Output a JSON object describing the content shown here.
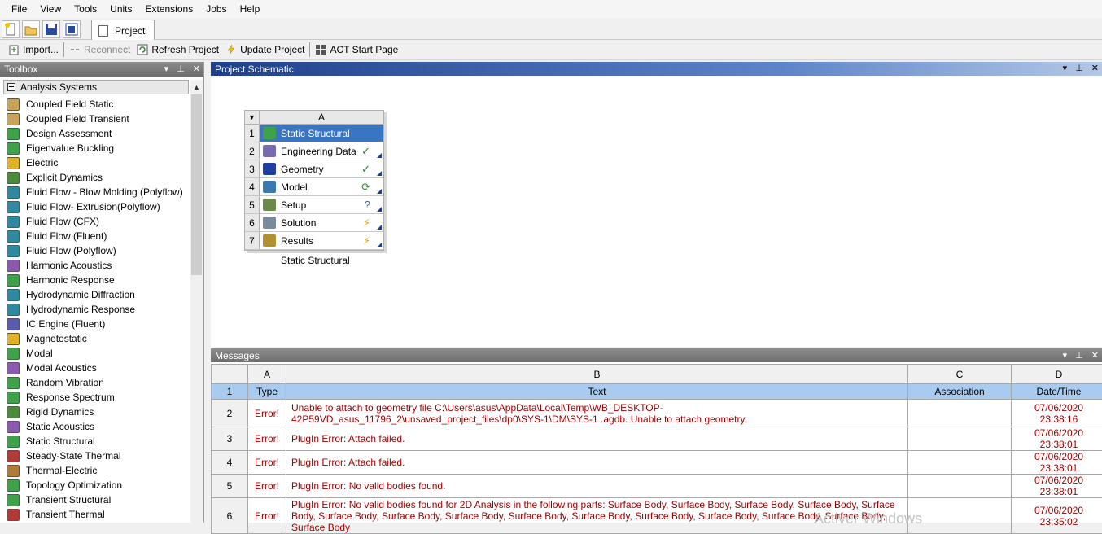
{
  "menu": [
    "File",
    "View",
    "Tools",
    "Units",
    "Extensions",
    "Jobs",
    "Help"
  ],
  "tab": {
    "label": "Project"
  },
  "actions": {
    "import": "Import...",
    "reconnect": "Reconnect",
    "refresh": "Refresh Project",
    "update": "Update Project",
    "act_start": "ACT Start Page"
  },
  "toolbox": {
    "title": "Toolbox",
    "pin": "▾",
    "dock": "⊥",
    "close": "✕",
    "group": "Analysis Systems",
    "items": [
      {
        "label": "Coupled Field Static",
        "color": "#c9a35a"
      },
      {
        "label": "Coupled Field Transient",
        "color": "#c9a35a"
      },
      {
        "label": "Design Assessment",
        "color": "#3ea24a"
      },
      {
        "label": "Eigenvalue Buckling",
        "color": "#3ea24a"
      },
      {
        "label": "Electric",
        "color": "#e0b22a"
      },
      {
        "label": "Explicit Dynamics",
        "color": "#4a8a3a"
      },
      {
        "label": "Fluid Flow - Blow Molding (Polyflow)",
        "color": "#2f8aa0"
      },
      {
        "label": "Fluid Flow- Extrusion(Polyflow)",
        "color": "#2f8aa0"
      },
      {
        "label": "Fluid Flow (CFX)",
        "color": "#2f8aa0"
      },
      {
        "label": "Fluid Flow (Fluent)",
        "color": "#2f8aa0"
      },
      {
        "label": "Fluid Flow (Polyflow)",
        "color": "#2f8aa0"
      },
      {
        "label": "Harmonic Acoustics",
        "color": "#8a5ab0"
      },
      {
        "label": "Harmonic Response",
        "color": "#3ea24a"
      },
      {
        "label": "Hydrodynamic Diffraction",
        "color": "#2f8aa0"
      },
      {
        "label": "Hydrodynamic Response",
        "color": "#2f8aa0"
      },
      {
        "label": "IC Engine (Fluent)",
        "color": "#5a5ab0"
      },
      {
        "label": "Magnetostatic",
        "color": "#e0b22a"
      },
      {
        "label": "Modal",
        "color": "#3ea24a"
      },
      {
        "label": "Modal Acoustics",
        "color": "#8a5ab0"
      },
      {
        "label": "Random Vibration",
        "color": "#3ea24a"
      },
      {
        "label": "Response Spectrum",
        "color": "#3ea24a"
      },
      {
        "label": "Rigid Dynamics",
        "color": "#4a8a3a"
      },
      {
        "label": "Static Acoustics",
        "color": "#8a5ab0"
      },
      {
        "label": "Static Structural",
        "color": "#3ea24a"
      },
      {
        "label": "Steady-State Thermal",
        "color": "#b03a3a"
      },
      {
        "label": "Thermal-Electric",
        "color": "#b07a3a"
      },
      {
        "label": "Topology Optimization",
        "color": "#3ea24a"
      },
      {
        "label": "Transient Structural",
        "color": "#3ea24a"
      },
      {
        "label": "Transient Thermal",
        "color": "#b03a3a"
      }
    ]
  },
  "schematic": {
    "title": "Project Schematic",
    "pin": "▾",
    "dock": "⊥",
    "close": "✕",
    "system": {
      "column": "A",
      "caption": "Static Structural",
      "rows": [
        {
          "num": "1",
          "label": "Static Structural",
          "state": "",
          "icon_color": "#3ea24a"
        },
        {
          "num": "2",
          "label": "Engineering Data",
          "state": "✓",
          "icon_color": "#7a6ab0"
        },
        {
          "num": "3",
          "label": "Geometry",
          "state": "✓",
          "icon_color": "#1e3ea0"
        },
        {
          "num": "4",
          "label": "Model",
          "state": "⟳",
          "icon_color": "#3a7ab0"
        },
        {
          "num": "5",
          "label": "Setup",
          "state": "?",
          "icon_color": "#6a8a4a"
        },
        {
          "num": "6",
          "label": "Solution",
          "state": "⚡",
          "icon_color": "#7a8a9a"
        },
        {
          "num": "7",
          "label": "Results",
          "state": "⚡",
          "icon_color": "#b09030"
        }
      ]
    }
  },
  "messages": {
    "title": "Messages",
    "pin": "▾",
    "dock": "⊥",
    "close": "✕",
    "col_letters": [
      "A",
      "B",
      "C",
      "D"
    ],
    "headers": {
      "row": "1",
      "type": "Type",
      "text": "Text",
      "association": "Association",
      "datetime": "Date/Time"
    },
    "rows": [
      {
        "num": "2",
        "type": "Error!",
        "text": "Unable to attach to geometry file C:\\Users\\asus\\AppData\\Local\\Temp\\WB_DESKTOP-42P59VD_asus_11796_2\\unsaved_project_files\\dp0\\SYS-1\\DM\\SYS-1 .agdb. Unable to attach geometry.",
        "association": "",
        "datetime": "07/06/2020 23:38:16"
      },
      {
        "num": "3",
        "type": "Error!",
        "text": "PlugIn Error: Attach failed.",
        "association": "",
        "datetime": "07/06/2020 23:38:01"
      },
      {
        "num": "4",
        "type": "Error!",
        "text": "PlugIn Error: Attach failed.",
        "association": "",
        "datetime": "07/06/2020 23:38:01"
      },
      {
        "num": "5",
        "type": "Error!",
        "text": "PlugIn Error: No valid bodies found.",
        "association": "",
        "datetime": "07/06/2020 23:38:01"
      },
      {
        "num": "6",
        "type": "Error!",
        "text": "PlugIn Error: No valid bodies found for 2D Analysis in the following parts: Surface Body, Surface Body, Surface Body, Surface Body, Surface Body, Surface Body, Surface Body, Surface Body, Surface Body, Surface Body, Surface Body, Surface Body, Surface Body, Surface Body, Surface Body",
        "association": "",
        "datetime": "07/06/2020 23:35:02"
      }
    ]
  },
  "watermark": "Activer Windows"
}
